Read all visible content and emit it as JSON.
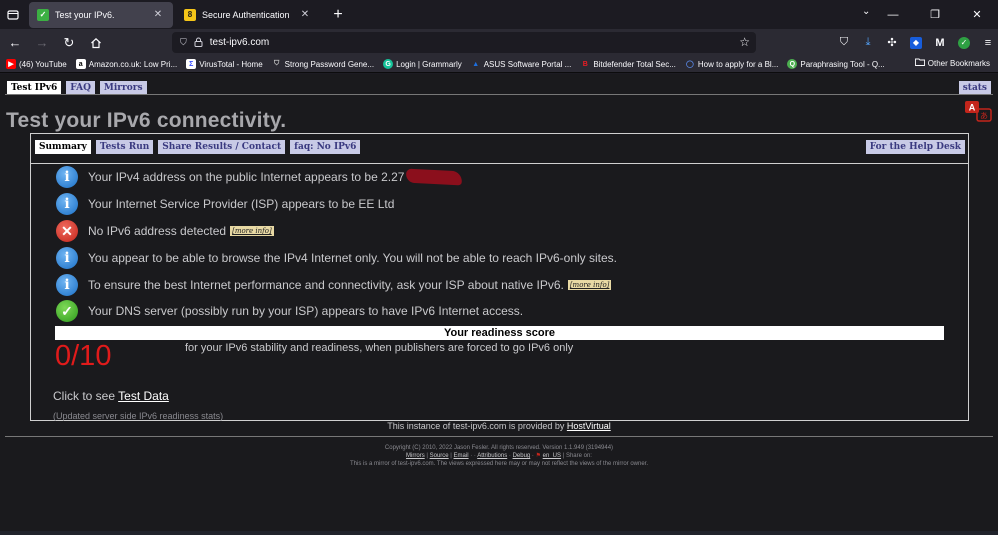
{
  "browser": {
    "tabs": [
      {
        "title": "Test your IPv6.",
        "active": true
      },
      {
        "title": "Secure Authentication",
        "active": false
      }
    ],
    "url": "test-ipv6.com",
    "bookmarks": [
      {
        "label": "(46) YouTube",
        "icon": "youtube-icon",
        "color": "#ff0000"
      },
      {
        "label": "Amazon.co.uk: Low Pri...",
        "icon": "amazon-icon",
        "color": "#ffffff"
      },
      {
        "label": "VirusTotal - Home",
        "icon": "virustotal-icon",
        "color": "#394eff"
      },
      {
        "label": "Strong Password Gene...",
        "icon": "shield-icon",
        "color": "#cccccc"
      },
      {
        "label": "Login | Grammarly",
        "icon": "grammarly-icon",
        "color": "#15c39a"
      },
      {
        "label": "ASUS Software Portal ...",
        "icon": "asus-icon",
        "color": "#1d6fe0"
      },
      {
        "label": "Bitdefender Total Sec...",
        "icon": "bitdefender-icon",
        "color": "#ed1c24"
      },
      {
        "label": "How to apply for a Bl...",
        "icon": "globe-icon",
        "color": "#5b8def"
      },
      {
        "label": "Paraphrasing Tool - Q...",
        "icon": "quillbot-icon",
        "color": "#4caf50"
      }
    ],
    "other_bookmarks": "Other Bookmarks"
  },
  "site": {
    "nav": [
      "Test IPv6",
      "FAQ",
      "Mirrors"
    ],
    "stats": "stats",
    "title": "Test your IPv6 connectivity.",
    "subtabs": [
      "Summary",
      "Tests Run",
      "Share Results / Contact",
      "faq: No IPv6"
    ],
    "helpdesk": "For the Help Desk",
    "results": [
      {
        "type": "info",
        "text": "Your IPv4 address on the public Internet appears to be 2.27",
        "more": ""
      },
      {
        "type": "info",
        "text": "Your Internet Service Provider (ISP) appears to be EE Ltd",
        "more": ""
      },
      {
        "type": "err",
        "text": "No IPv6 address detected",
        "more": "[more info]"
      },
      {
        "type": "info",
        "text": "You appear to be able to browse the IPv4 Internet only. You will not be able to reach IPv6-only sites.",
        "more": ""
      },
      {
        "type": "info",
        "text": "To ensure the best Internet performance and connectivity, ask your ISP about native IPv6.",
        "more": "[more info]"
      },
      {
        "type": "ok",
        "text": "Your DNS server (possibly run by your ISP) appears to have IPv6 Internet access.",
        "more": ""
      }
    ],
    "readiness_heading": "Your readiness score",
    "score": "0/10",
    "score_desc": "for your IPv6 stability and readiness, when publishers are forced to go IPv6 only",
    "test_data_prefix": "Click to see ",
    "test_data_link": "Test Data",
    "updated": "(Updated server side IPv6 readiness stats)",
    "provided_prefix": "This instance of test-ipv6.com is provided by ",
    "provided_link": "HostVirtual",
    "copyright": "Copyright (C) 2010, 2022 Jason Fesler. All rights reserved. Version 1.1.949 (3194944)",
    "footer_links": [
      "Mirrors",
      "Source",
      "Email",
      "Attributions",
      "Debug",
      "en_US"
    ],
    "share_on": "Share on:",
    "mirror_note": "This is a mirror of test-ipv6.com. The views expressed here may or may not reflect the views of the mirror owner."
  }
}
